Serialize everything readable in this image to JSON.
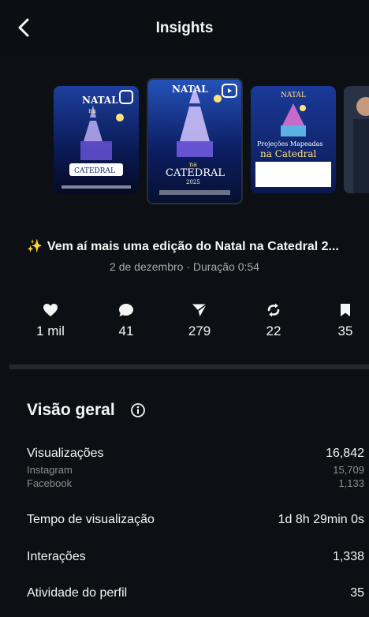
{
  "header": {
    "title": "Insights"
  },
  "post": {
    "caption": "Vem aí mais uma edição do Natal na Catedral 2...",
    "sparkle": "✨",
    "meta": "2 de dezembro · Duração 0:54"
  },
  "thumbnails": [
    {
      "l1": "NATAL",
      "l2": "na",
      "l3": "CATEDRAL"
    },
    {
      "l1": "NATAL",
      "l2": "na",
      "l3": "CATEDRAL",
      "l4": "2025"
    },
    {
      "l1": "NATAL",
      "l2": "Projeções Mapeadas",
      "l3": "na Catedral"
    }
  ],
  "stats": [
    {
      "icon": "heart-icon",
      "value": "1 mil"
    },
    {
      "icon": "comment-icon",
      "value": "41"
    },
    {
      "icon": "share-icon",
      "value": "279"
    },
    {
      "icon": "repost-icon",
      "value": "22"
    },
    {
      "icon": "bookmark-icon",
      "value": "35"
    }
  ],
  "overview": {
    "title": "Visão geral",
    "views_label": "Visualizações",
    "views_value": "16,842",
    "instagram_label": "Instagram",
    "instagram_value": "15,709",
    "facebook_label": "Facebook",
    "facebook_value": "1,133",
    "watch_time_label": "Tempo de visualização",
    "watch_time_value": "1d 8h 29min 0s",
    "interactions_label": "Interações",
    "interactions_value": "1,338",
    "profile_activity_label": "Atividade do perfil",
    "profile_activity_value": "35"
  },
  "colors": {
    "background": "#0c1014",
    "muted": "#8e8e8e",
    "divider": "#24292f"
  }
}
